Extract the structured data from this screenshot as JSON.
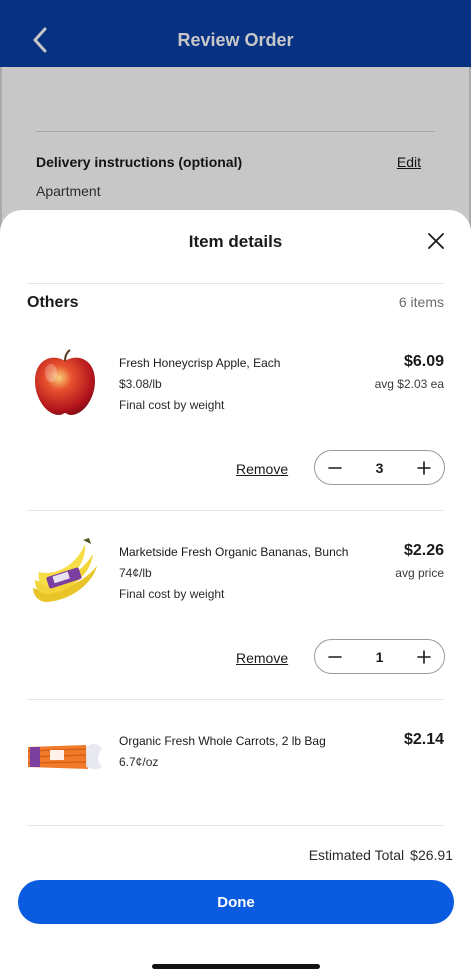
{
  "header": {
    "title": "Review Order"
  },
  "background": {
    "delivery_label": "Delivery instructions (optional)",
    "delivery_edit": "Edit",
    "delivery_value": "Apartment"
  },
  "sheet": {
    "title": "Item details",
    "section_title": "Others",
    "section_count": "6 items",
    "items": [
      {
        "name": "Fresh Honeycrisp Apple, Each",
        "unit_price": "$3.08/lb",
        "note": "Final cost by weight",
        "price": "$6.09",
        "price_sub": "avg $2.03 ea",
        "remove_label": "Remove",
        "quantity": "3"
      },
      {
        "name": "Marketside Fresh Organic Bananas, Bunch",
        "unit_price": "74¢/lb",
        "note": "Final cost by weight",
        "price": "$2.26",
        "price_sub": "avg price",
        "remove_label": "Remove",
        "quantity": "1"
      },
      {
        "name": "Organic Fresh Whole Carrots, 2 lb Bag",
        "unit_price": "6.7¢/oz",
        "price": "$2.14"
      }
    ],
    "estimated_total_label": "Estimated Total",
    "estimated_total_value": "$26.91",
    "done_label": "Done"
  },
  "colors": {
    "header_blue": "#0a3fa8",
    "button_blue": "#0a5be0"
  }
}
